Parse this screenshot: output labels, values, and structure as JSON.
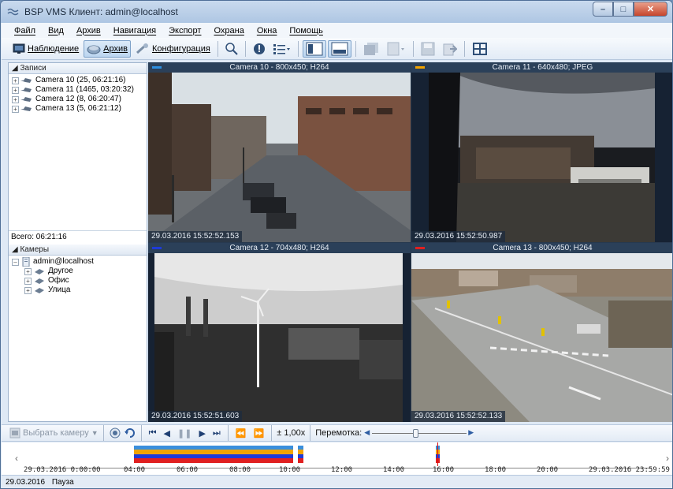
{
  "window": {
    "title": "BSP VMS Клиент: admin@localhost"
  },
  "menu": [
    "Файл",
    "Вид",
    "Архив",
    "Навигация",
    "Экспорт",
    "Охрана",
    "Окна",
    "Помощь"
  ],
  "toolbar": {
    "monitoring": "Наблюдение",
    "archive": "Архив",
    "configuration": "Конфигурация"
  },
  "records": {
    "header": "Записи",
    "items": [
      "Camera 10 (25, 06:21:16)",
      "Camera 11 (1465, 03:20:32)",
      "Camera 12 (8, 06:20:47)",
      "Camera 13 (5, 06:21:12)"
    ],
    "total": "Всего: 06:21:16"
  },
  "cameras": {
    "header": "Камеры",
    "server": "admin@localhost",
    "groups": [
      "Другое",
      "Офис",
      "Улица"
    ]
  },
  "tiles": [
    {
      "title": "Camera 10 - 800x450; H264",
      "timestamp": "29.03.2016 15:52:52.153",
      "tag_color": "#2d8fe0"
    },
    {
      "title": "Camera 11 - 640x480; JPEG",
      "timestamp": "29.03.2016 15:52:50.987",
      "tag_color": "#f2a400"
    },
    {
      "title": "Camera 12 - 704x480; H264",
      "timestamp": "29.03.2016 15:52:51.603",
      "tag_color": "#1e3ad8"
    },
    {
      "title": "Camera 13 - 800x450; H264",
      "timestamp": "29.03.2016 15:52:52.133",
      "tag_color": "#e02020"
    }
  ],
  "playback": {
    "select_camera": "Выбрать камеру",
    "speed": "± 1,00x",
    "rewind_label": "Перемотка:"
  },
  "timeline": {
    "start": "29.03.2016 0:00:00",
    "end": "29.03.2016 23:59:59",
    "ticks": [
      "04:00",
      "06:00",
      "08:00",
      "10:00",
      "12:00",
      "14:00",
      "16:00",
      "18:00",
      "20:00"
    ]
  },
  "status": {
    "date": "29.03.2016",
    "state": "Пауза"
  }
}
